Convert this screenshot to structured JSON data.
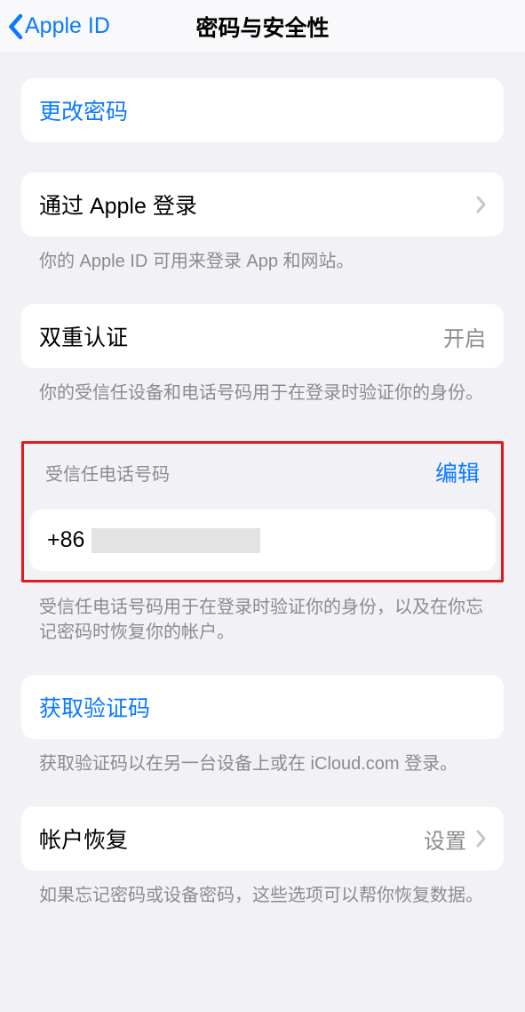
{
  "nav": {
    "back_label": "Apple ID",
    "title": "密码与安全性"
  },
  "change_password": {
    "label": "更改密码"
  },
  "sign_in_with_apple": {
    "label": "通过 Apple 登录",
    "footer": "你的 Apple ID 可用来登录 App 和网站。"
  },
  "two_factor": {
    "label": "双重认证",
    "status": "开启",
    "footer": "你的受信任设备和电话号码用于在登录时验证你的身份。"
  },
  "trusted_phone": {
    "header": "受信任电话号码",
    "edit": "编辑",
    "prefix": "+86",
    "footer": "受信任电话号码用于在登录时验证你的身份，以及在你忘记密码时恢复你的帐户。"
  },
  "get_code": {
    "label": "获取验证码",
    "footer": "获取验证码以在另一台设备上或在 iCloud.com 登录。"
  },
  "account_recovery": {
    "label": "帐户恢复",
    "status": "设置",
    "footer": "如果忘记密码或设备密码，这些选项可以帮你恢复数据。"
  }
}
